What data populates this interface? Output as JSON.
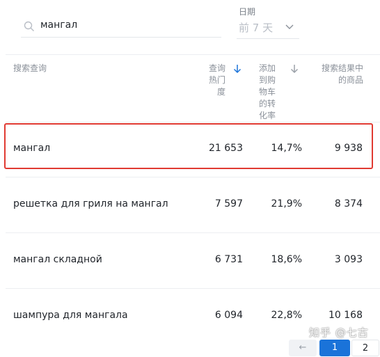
{
  "search": {
    "value": "мангал"
  },
  "date": {
    "label": "日期",
    "value": "前 7 天"
  },
  "table": {
    "headers": {
      "query": "搜索查询",
      "popularity": [
        "查询",
        "热门",
        "度"
      ],
      "conversion": [
        "添加",
        "到购",
        "物车",
        "的转",
        "化率"
      ],
      "results": [
        "搜索结果中",
        "的商品"
      ]
    },
    "rows": [
      {
        "query": "мангал",
        "popularity": "21 653",
        "conversion": "14,7%",
        "results": "9 938"
      },
      {
        "query": "решетка для гриля на мангал",
        "popularity": "7 597",
        "conversion": "21,9%",
        "results": "8 374"
      },
      {
        "query": "мангал складной",
        "popularity": "6 731",
        "conversion": "18,6%",
        "results": "3 093"
      },
      {
        "query": "шампура для мангала",
        "popularity": "6 094",
        "conversion": "22,8%",
        "results": "10 168"
      }
    ]
  },
  "footer": {
    "text": "...",
    "page_current": "1",
    "page_next": "2",
    "page_prev": "←"
  },
  "watermark": "知乎 @七古",
  "colors": {
    "highlight": "#e03a32",
    "accent": "#1a73d9"
  }
}
